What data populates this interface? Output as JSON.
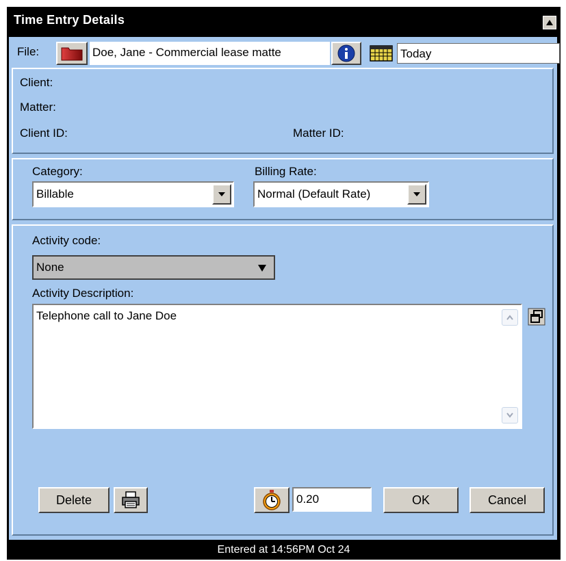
{
  "window": {
    "title": "Time Entry Details"
  },
  "file_row": {
    "label": "File:",
    "file_value": "Doe, Jane - Commercial lease matte",
    "date_value": "Today"
  },
  "client_panel": {
    "client_label": "Client:",
    "matter_label": "Matter:",
    "client_id_label": "Client ID:",
    "matter_id_label": "Matter ID:"
  },
  "category": {
    "label": "Category:",
    "value": "Billable"
  },
  "billing_rate": {
    "label": "Billing Rate:",
    "value": "Normal (Default Rate)"
  },
  "activity": {
    "code_label": "Activity code:",
    "code_value": "None",
    "description_label": "Activity Description:",
    "description_value": "Telephone call to Jane Doe"
  },
  "buttons": {
    "delete": "Delete",
    "ok": "OK",
    "cancel": "Cancel"
  },
  "time": {
    "value": "0.20"
  },
  "status": {
    "text": "Entered at 14:56PM Oct 24"
  },
  "colors": {
    "panel_bg": "#a6c8ee",
    "frame": "#000000",
    "button_face": "#d4d0c8"
  },
  "icons": [
    "collapse-arrow-icon",
    "folder-icon",
    "info-icon",
    "calendar-icon",
    "dropdown-arrow-icon",
    "restore-icon",
    "printer-icon",
    "stopwatch-icon"
  ]
}
